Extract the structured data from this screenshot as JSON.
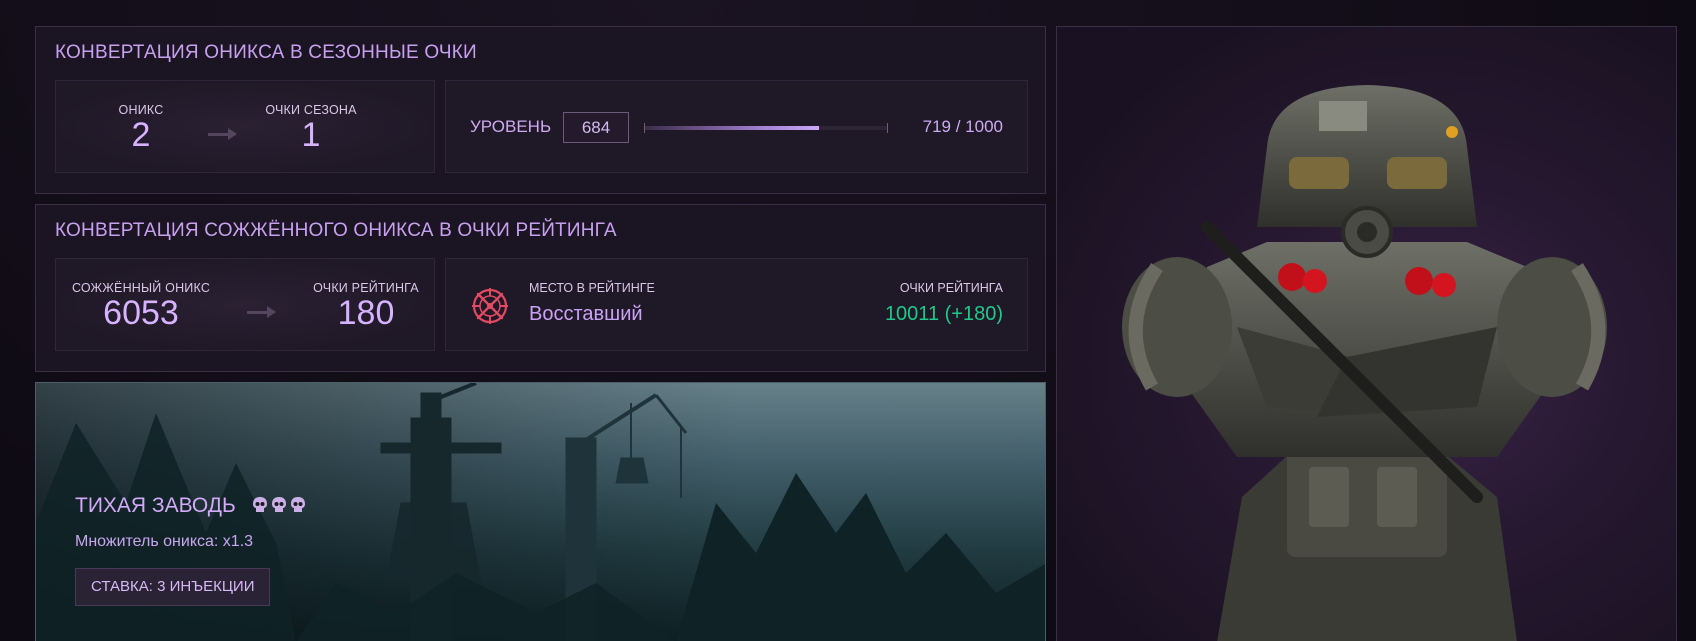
{
  "onyx_conversion": {
    "title": "КОНВЕРТАЦИЯ ОНИКСА В СЕЗОННЫЕ ОЧКИ",
    "onyx_label": "ОНИКС",
    "onyx_value": "2",
    "season_points_label": "ОЧКИ СЕЗОНА",
    "season_points_value": "1",
    "level_label": "УРОВЕНЬ",
    "level_value": "684",
    "level_progress_text": "719 / 1000",
    "level_progress_fraction": 0.719
  },
  "burned_conversion": {
    "title": "КОНВЕРТАЦИЯ СОЖЖЁННОГО ОНИКСА В ОЧКИ РЕЙТИНГА",
    "burned_label": "СОЖЖЁННЫЙ ОНИКС",
    "burned_value": "6053",
    "rating_points_label": "ОЧКИ РЕЙТИНГА",
    "rating_points_value": "180",
    "rank_place_label": "МЕСТО В РЕЙТИНГЕ",
    "rank_place_value": "Восставший",
    "rank_points_label": "ОЧКИ РЕЙТИНГА",
    "rank_points_value": "10011 (+180)",
    "rank_points_color": "#1fc98a"
  },
  "mode": {
    "name": "ТИХАЯ ЗАВОДЬ",
    "difficulty_skulls": 3,
    "multiplier_text": "Множитель оникса:  x1.3",
    "bet_label": "СТАВКА: 3 ИНЪЕКЦИИ"
  },
  "icons": {
    "arrow": "arrow-right-icon",
    "rank": "rank-emblem-icon",
    "skull": "skull-icon"
  },
  "colors": {
    "accent": "#c8a0f0",
    "panel_bg": "#1b1422",
    "positive": "#1fc98a"
  }
}
